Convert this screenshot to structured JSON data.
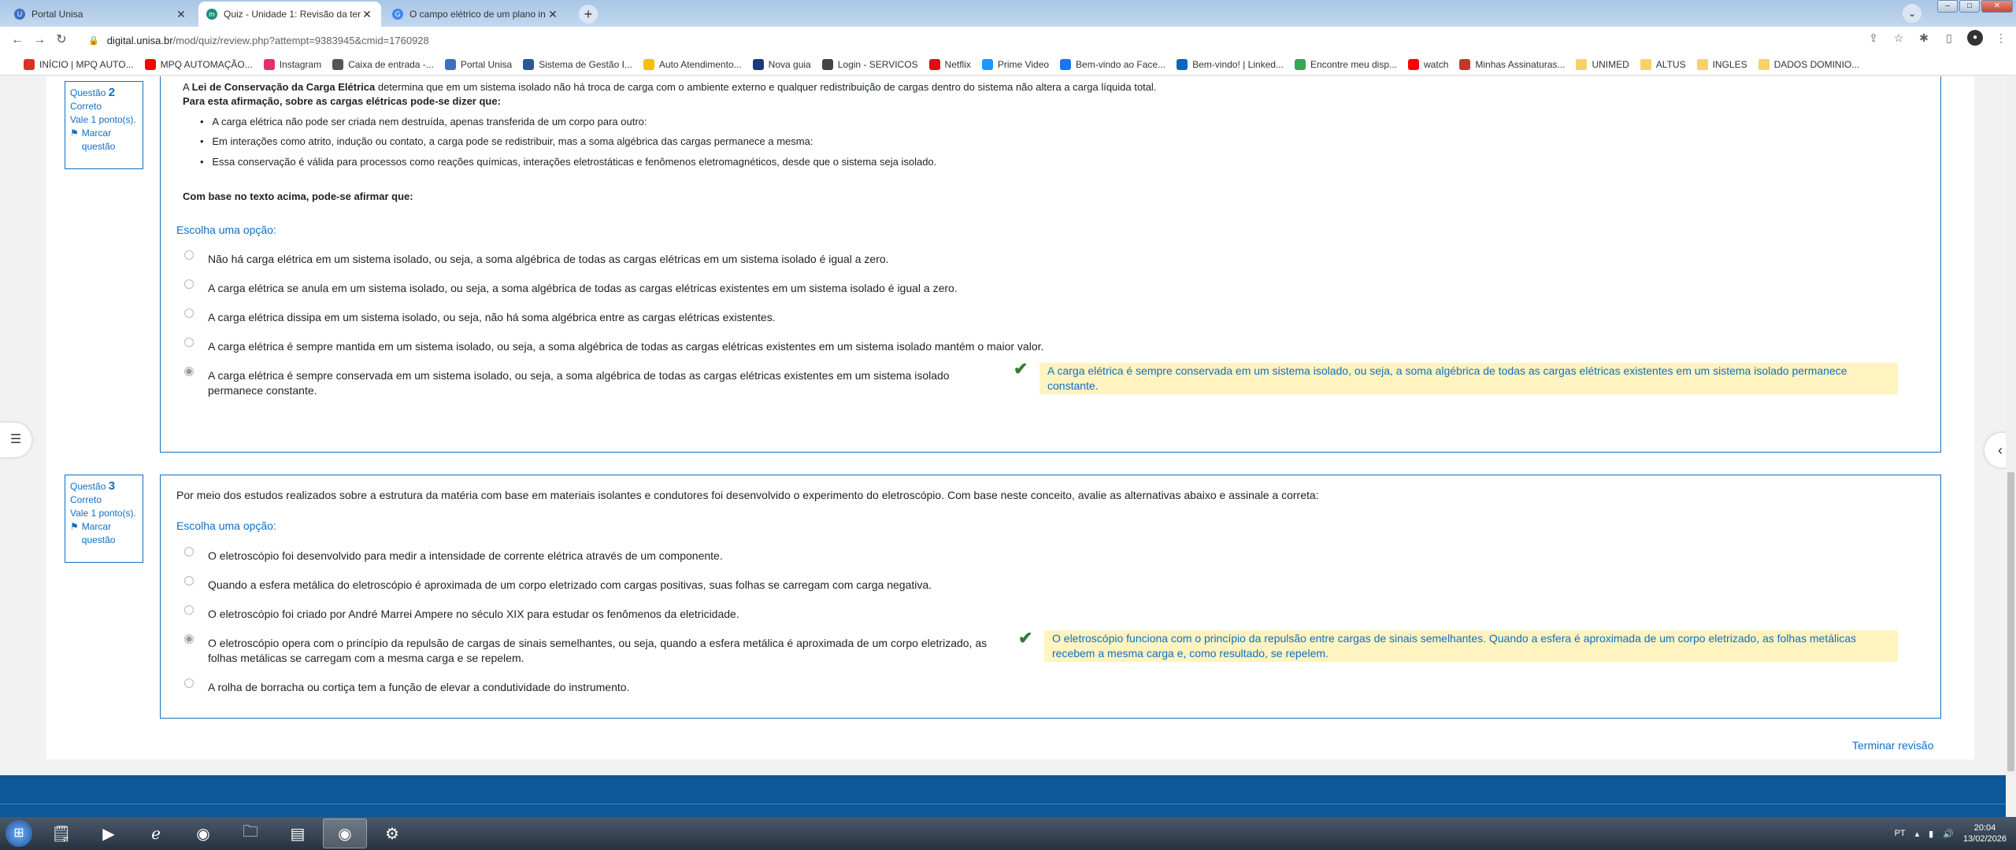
{
  "browser": {
    "tabs": [
      {
        "title": "Portal Unisa",
        "favicon_color": "#3a6fc4",
        "active": false
      },
      {
        "title": "Quiz - Unidade 1: Revisão da ter",
        "favicon_color": "#1a8f7a",
        "active": true
      },
      {
        "title": "O campo elétrico de um plano in",
        "favicon_color": "#4285f4",
        "active": false
      }
    ],
    "new_tab": "+",
    "url_host": "digital.unisa.br",
    "url_path": "/mod/quiz/review.php?attempt=9383945&cmid=1760928"
  },
  "bookmarks": [
    {
      "label": "INÍCIO | MPQ AUTO...",
      "color": "#d93025"
    },
    {
      "label": "MPQ AUTOMAÇÃO...",
      "color": "#ff0000"
    },
    {
      "label": "Instagram",
      "color": "#e1306c"
    },
    {
      "label": "Caixa de entrada -...",
      "color": "#555555"
    },
    {
      "label": "Portal Unisa",
      "color": "#3a6fc4"
    },
    {
      "label": "Sistema de Gestão I...",
      "color": "#2b5797"
    },
    {
      "label": "Auto Atendimento...",
      "color": "#f2c200"
    },
    {
      "label": "Nova guia",
      "color": "#1a3a7a"
    },
    {
      "label": "Login - SERVICOS",
      "color": "#444444"
    },
    {
      "label": "Netflix",
      "color": "#e50914"
    },
    {
      "label": "Prime Video",
      "color": "#1a98ff"
    },
    {
      "label": "Bem-vindo ao Face...",
      "color": "#1877f2"
    },
    {
      "label": "Bem-vindo! | Linked...",
      "color": "#0a66c2"
    },
    {
      "label": "Encontre meu disp...",
      "color": "#34a853"
    },
    {
      "label": "watch",
      "color": "#ff0000"
    },
    {
      "label": "Minhas Assinaturas...",
      "color": "#c0392b"
    },
    {
      "label": "UNIMED",
      "color": "folder"
    },
    {
      "label": "ALTUS",
      "color": "folder"
    },
    {
      "label": "INGLES",
      "color": "folder"
    },
    {
      "label": "DADOS DOMINIO...",
      "color": "folder"
    }
  ],
  "q2": {
    "info": {
      "label": "Questão",
      "number": "2",
      "status": "Correto",
      "grade": "Vale 1 ponto(s).",
      "flag": "Marcar questão"
    },
    "intro_pre": "A ",
    "intro_bold": "Lei de Conservação da Carga Elétrica",
    "intro_post": " determina que em um sistema isolado não há troca de carga com o ambiente externo e qualquer redistribuição de cargas dentro do sistema não altera a carga líquida total.",
    "subhead": "Para esta afirmação, sobre as cargas elétricas pode-se dizer que:",
    "bullets": [
      "A carga elétrica não pode ser criada nem destruída, apenas transferida de um corpo para outro:",
      "Em interações como atrito, indução ou contato, a carga pode se redistribuir, mas a soma algébrica das cargas permanece a mesma:",
      "Essa conservação é válida para processos como reações químicas, interações eletrostáticas e fenômenos eletromagnéticos, desde que o sistema seja isolado."
    ],
    "question": "Com base no texto acima, pode-se afirmar que:",
    "prompt": "Escolha uma opção:",
    "options": [
      "Não há carga elétrica em um sistema isolado, ou seja, a soma algébrica de todas as cargas elétricas em um sistema isolado é igual a zero.",
      "A carga elétrica se anula em um sistema isolado, ou seja, a soma algébrica de todas as cargas elétricas existentes em um sistema isolado é igual a zero.",
      "A carga elétrica dissipa em um sistema isolado, ou seja, não há soma algébrica entre as cargas elétricas existentes.",
      "A carga elétrica é sempre mantida em um sistema isolado, ou seja, a soma algébrica de todas as cargas elétricas existentes em um sistema isolado mantém o maior valor.",
      "A carga elétrica é sempre conservada em um sistema isolado, ou seja, a soma algébrica de todas as cargas elétricas existentes em um sistema isolado permanece constante."
    ],
    "selected": 4,
    "feedback": "A carga elétrica é sempre conservada em um sistema isolado, ou seja, a soma algébrica de todas as cargas elétricas existentes em um sistema isolado permanece constante."
  },
  "q3": {
    "info": {
      "label": "Questão",
      "number": "3",
      "status": "Correto",
      "grade": "Vale 1 ponto(s).",
      "flag": "Marcar questão"
    },
    "question": "Por meio dos estudos realizados sobre a estrutura da matéria com base em materiais isolantes e condutores foi desenvolvido o experimento do eletroscópio. Com base neste conceito, avalie as alternativas abaixo e assinale a correta:",
    "prompt": "Escolha uma opção:",
    "options": [
      "O eletroscópio foi desenvolvido para medir a intensidade de corrente elétrica através de um componente.",
      "Quando a esfera metálica do eletroscópio é aproximada de um corpo eletrizado com cargas positivas, suas folhas se carregam com carga negativa.",
      "O eletroscópio foi criado por André Marrei Ampere no século XIX para estudar os fenômenos da eletricidade.",
      "O eletroscópio opera com o princípio da repulsão de cargas de sinais semelhantes, ou seja, quando a esfera metálica é aproximada de um corpo eletrizado, as folhas metálicas se carregam com a mesma carga e se repelem.",
      "A rolha de borracha ou cortiça tem a função de elevar a condutividade do instrumento."
    ],
    "selected": 3,
    "feedback": "O eletroscópio funciona com o princípio da repulsão entre cargas de sinais semelhantes. Quando a esfera é aproximada de um corpo eletrizado, as folhas metálicas recebem a mesma carga e, como resultado, se repelem."
  },
  "finish_review": "Terminar revisão",
  "tray": {
    "lang": "PT",
    "time": "20:04",
    "date": "13/02/2026"
  },
  "colors": {
    "accent": "#0f6fc5",
    "correct": "#357a32",
    "feedback_bg": "#fff3c0",
    "footer": "#0c5898"
  }
}
